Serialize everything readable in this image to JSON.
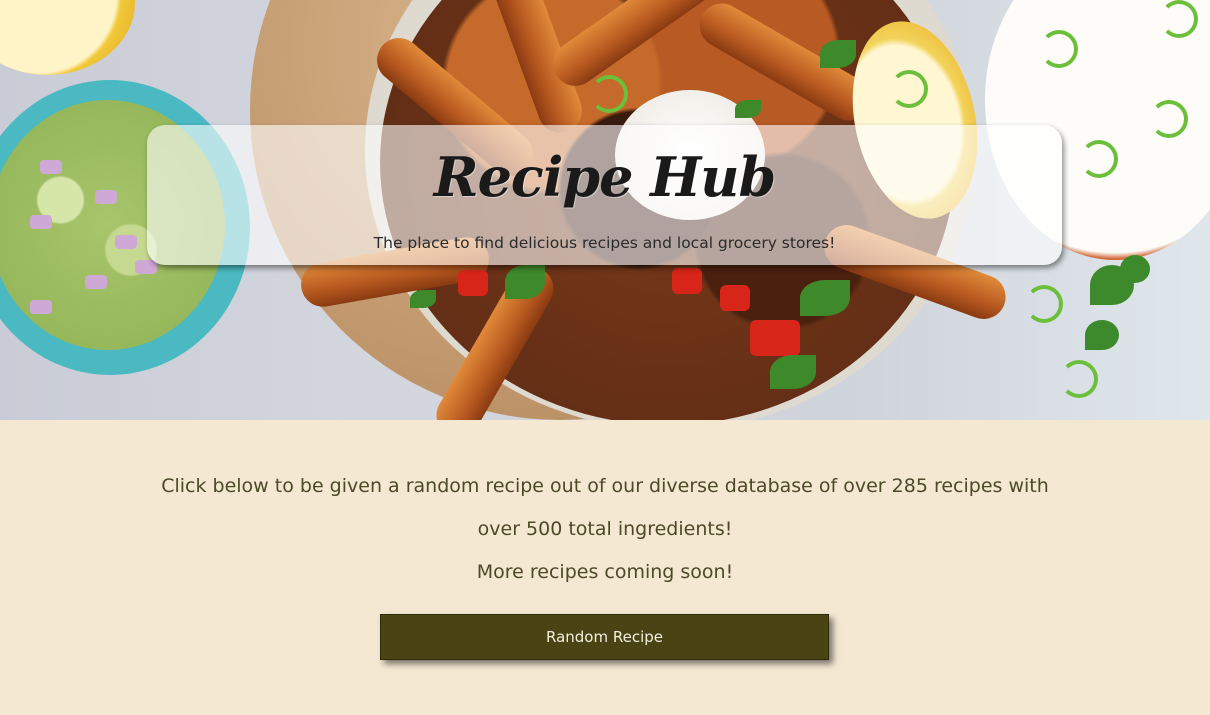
{
  "header": {
    "title": "Recipe Hub",
    "tagline": "The place to find delicious recipes and local grocery stores!"
  },
  "main": {
    "intro": "Click below to be given a random recipe out of our diverse database of over 285 recipes with over 500 total ingredients!",
    "note": "More recipes coming soon!",
    "button_label": "Random Recipe"
  },
  "colors": {
    "page_background": "#f5e8d3",
    "button_background": "#4a4414",
    "body_text": "#4a4a26"
  }
}
